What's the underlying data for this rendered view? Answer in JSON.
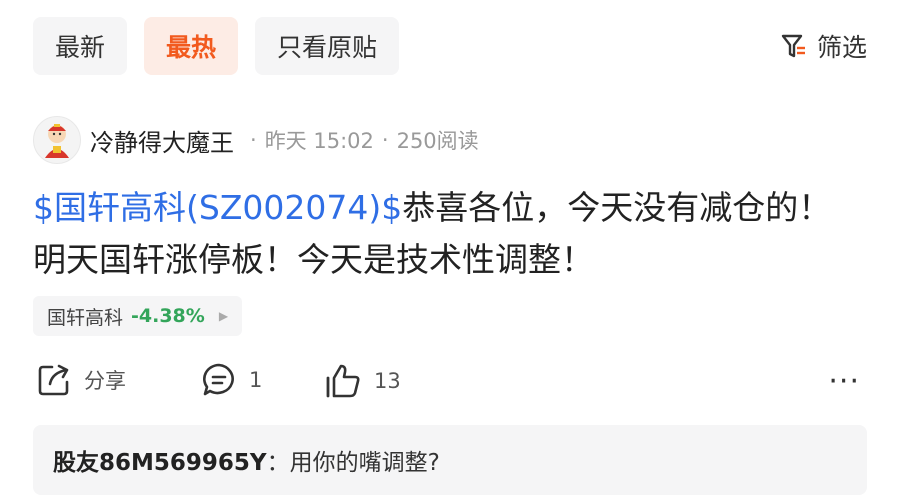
{
  "tabs": [
    {
      "label": "最新",
      "active": false
    },
    {
      "label": "最热",
      "active": true
    },
    {
      "label": "只看原贴",
      "active": false
    }
  ],
  "filter": {
    "label": "筛选",
    "icon": "filter-icon"
  },
  "post": {
    "author": "冷静得大魔王",
    "time": "昨天 15:02",
    "reads": "250阅读",
    "separator": "·",
    "stock_link": "$国轩高科(SZ002074)$",
    "text_line1": "恭喜各位，今天没有减仓的！",
    "text_line2": "明天国轩涨停板！今天是技术性调整！",
    "stock_tag": {
      "name": "国轩高科",
      "change": "-4.38%",
      "change_color": "#33a55a"
    }
  },
  "actions": {
    "share_label": "分享",
    "comment_count": "1",
    "like_count": "13",
    "more": "···"
  },
  "comment": {
    "user": "股友86M569965Y",
    "colon": "：",
    "text": "用你的嘴调整?"
  },
  "colors": {
    "accent": "#f25a1e",
    "link": "#2f6ee5",
    "down": "#33a55a"
  }
}
